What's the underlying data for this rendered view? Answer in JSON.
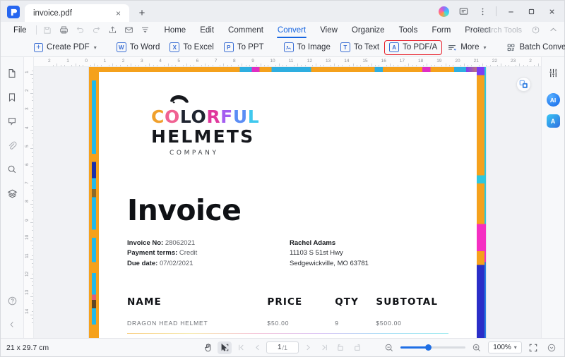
{
  "window": {
    "tab_title": "invoice.pdf",
    "new_tab_label": "+",
    "close_tab_label": "×",
    "minimize_label": "–",
    "maximize_label": "▫",
    "close_label": "×"
  },
  "menubar": {
    "file_label": "File",
    "icons": [
      "save-icon",
      "print-icon",
      "undo-icon",
      "redo-icon",
      "share-icon",
      "email-icon",
      "download-icon"
    ],
    "tabs": [
      {
        "label": "Home",
        "active": false
      },
      {
        "label": "Edit",
        "active": false
      },
      {
        "label": "Comment",
        "active": false
      },
      {
        "label": "Convert",
        "active": true
      },
      {
        "label": "View",
        "active": false
      },
      {
        "label": "Organize",
        "active": false
      },
      {
        "label": "Tools",
        "active": false
      },
      {
        "label": "Form",
        "active": false
      },
      {
        "label": "Protect",
        "active": false
      }
    ],
    "search_placeholder": "Search Tools"
  },
  "ribbon": {
    "items": [
      {
        "label": "Create PDF",
        "icon": "plus-square-icon",
        "has_caret": true,
        "highlight": false
      },
      {
        "label": "To Word",
        "icon": "word-icon",
        "glyph": "W",
        "has_caret": false,
        "highlight": false
      },
      {
        "label": "To Excel",
        "icon": "excel-icon",
        "glyph": "X",
        "has_caret": false,
        "highlight": false
      },
      {
        "label": "To PPT",
        "icon": "ppt-icon",
        "glyph": "P",
        "has_caret": false,
        "highlight": false
      },
      {
        "label": "To Image",
        "icon": "image-icon",
        "glyph": "▤",
        "has_caret": false,
        "highlight": false
      },
      {
        "label": "To Text",
        "icon": "text-icon",
        "glyph": "T",
        "has_caret": false,
        "highlight": false
      },
      {
        "label": "To PDF/A",
        "icon": "pdfa-icon",
        "glyph": "A",
        "has_caret": false,
        "highlight": true
      },
      {
        "label": "More",
        "icon": "more-lines-icon",
        "has_caret": true,
        "highlight": false
      },
      {
        "label": "Batch Convert",
        "icon": "batch-icon",
        "has_caret": false,
        "highlight": false
      }
    ],
    "highlight_color": "#e8212c",
    "accent_color": "#1765e0"
  },
  "left_rail": {
    "items": [
      {
        "name": "thumbnails-icon"
      },
      {
        "name": "bookmark-icon"
      },
      {
        "name": "comment-icon"
      },
      {
        "name": "attachment-icon"
      },
      {
        "name": "search-icon"
      },
      {
        "name": "layers-icon"
      }
    ],
    "help_label": "?",
    "collapse_label": "‹"
  },
  "right_rail": {
    "settings_icon": "sliders-icon",
    "ai_label": "AI",
    "translate_label": "A"
  },
  "rulers": {
    "horizontal": [
      "2",
      "1",
      "0",
      "1",
      "2",
      "3",
      "4",
      "5",
      "6",
      "7",
      "8",
      "9",
      "10",
      "11",
      "12",
      "13",
      "14",
      "15",
      "16",
      "17",
      "18",
      "19",
      "20",
      "21",
      "22",
      "23",
      "2"
    ],
    "vertical": [
      "1",
      "2",
      "3",
      "4",
      "5",
      "6",
      "7",
      "8",
      "9",
      "10",
      "11",
      "12",
      "13",
      "14"
    ]
  },
  "document": {
    "brand": {
      "letters": [
        {
          "ch": "C",
          "color": "#f0a02c"
        },
        {
          "ch": "O",
          "color": "#f06292"
        },
        {
          "ch": "L",
          "color": "#1f2430"
        },
        {
          "ch": "O",
          "color": "#1f2430"
        },
        {
          "ch": "R",
          "color": "#e0379c"
        },
        {
          "ch": "F",
          "color": "#a35df0"
        },
        {
          "ch": "U",
          "color": "#5b8df5"
        },
        {
          "ch": "L",
          "color": "#3fc8ee"
        }
      ],
      "line2": "HELMETS",
      "line3": "COMPANY"
    },
    "title": "Invoice",
    "meta_left": [
      {
        "label": "Invoice No:",
        "value": "28062021"
      },
      {
        "label": "Payment terms:",
        "value": "Credit"
      },
      {
        "label": "Due date:",
        "value": "07/02/2021"
      }
    ],
    "meta_right": {
      "name": "Rachel Adams",
      "address1": "11103 S 51st Hwy",
      "address2": "Sedgewickville, MO 63781"
    },
    "table": {
      "columns": [
        "NAME",
        "PRICE",
        "QTY",
        "SUBTOTAL"
      ],
      "rows": [
        {
          "name": "DRAGON HEAD HELMET",
          "price": "$50.00",
          "qty": "9",
          "subtotal": "$500.00"
        }
      ]
    }
  },
  "statusbar": {
    "page_size": "21 x 29.7 cm",
    "hand_tool": "hand-icon",
    "select_tool": "select-icon",
    "page_current": "1",
    "page_total": "/1",
    "zoom_value": "100%",
    "zoom_out_icon": "zoom-out-icon",
    "zoom_in_icon": "zoom-in-icon",
    "fit_icon": "fit-screen-icon",
    "more_icon": "chevron-down-circle-icon"
  }
}
